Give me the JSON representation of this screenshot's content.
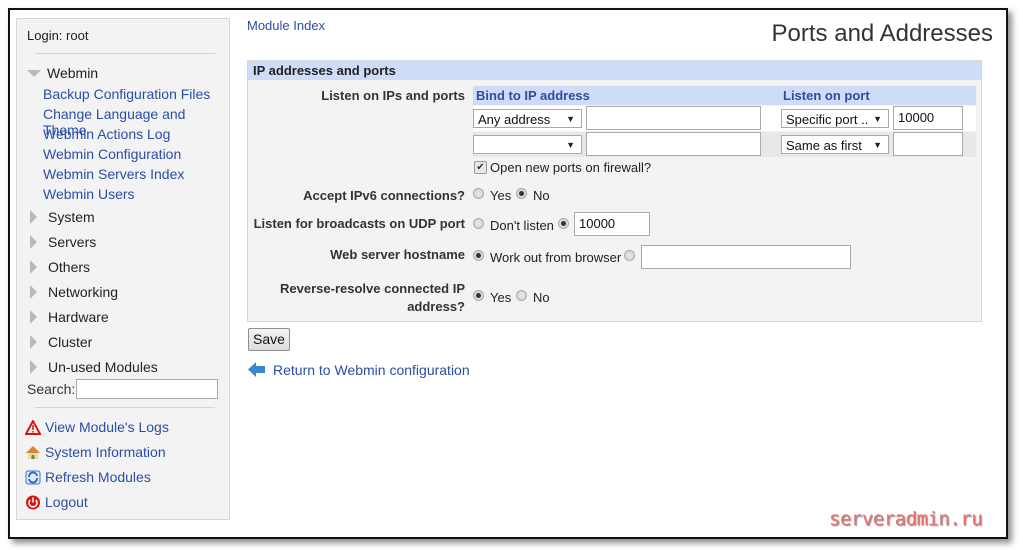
{
  "sidebar": {
    "login": "Login: root",
    "webmin_category": "Webmin",
    "webmin_links": [
      "Backup Configuration Files",
      "Change Language and Theme",
      "Webmin Actions Log",
      "Webmin Configuration",
      "Webmin Servers Index",
      "Webmin Users"
    ],
    "categories": [
      "System",
      "Servers",
      "Others",
      "Networking",
      "Hardware",
      "Cluster",
      "Un-used Modules"
    ],
    "search_label": "Search:",
    "search_value": "",
    "tools": [
      {
        "label": "View Module's Logs",
        "icon": "warning-icon"
      },
      {
        "label": "System Information",
        "icon": "home-icon"
      },
      {
        "label": "Refresh Modules",
        "icon": "refresh-icon"
      },
      {
        "label": "Logout",
        "icon": "power-icon"
      }
    ]
  },
  "header": {
    "module_index": "Module Index",
    "title": "Ports and Addresses"
  },
  "panel": {
    "title": "IP addresses and ports",
    "listen_label": "Listen on IPs and ports",
    "columns": [
      "Bind to IP address",
      "Listen on port"
    ],
    "rows": [
      {
        "ip_select": "Any address",
        "ip_value": "",
        "port_select": "Specific port ..",
        "port_value": "10000"
      },
      {
        "ip_select": "",
        "ip_value": "",
        "port_select": "Same as first",
        "port_value": ""
      }
    ],
    "firewall_label": "Open new ports on firewall?",
    "firewall_checked": true,
    "ipv6": {
      "label": "Accept IPv6 connections?",
      "options": [
        "Yes",
        "No"
      ],
      "selected": "No"
    },
    "udp": {
      "label": "Listen for broadcasts on UDP port",
      "options": [
        "Don't listen"
      ],
      "selected": "custom",
      "value": "10000"
    },
    "hostname": {
      "label": "Web server hostname",
      "options": [
        "Work out from browser"
      ],
      "selected": "Work out from browser",
      "value": ""
    },
    "reverse": {
      "label_line1": "Reverse-resolve connected IP",
      "label_line2": "address?",
      "options": [
        "Yes",
        "No"
      ],
      "selected": "Yes"
    }
  },
  "actions": {
    "save": "Save",
    "return": "Return to Webmin configuration"
  },
  "watermark": "serveradmin.ru"
}
